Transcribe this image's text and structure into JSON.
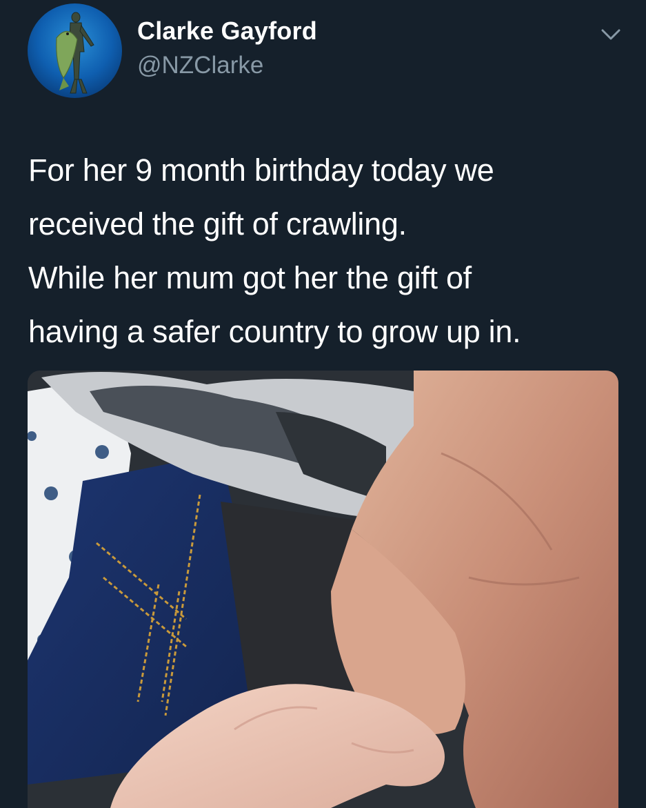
{
  "author": {
    "display_name": "Clarke Gayford",
    "handle": "@NZClarke",
    "avatar_icon": "diver-avatar-icon"
  },
  "menu": {
    "icon": "chevron-down-icon"
  },
  "tweet": {
    "lines": [
      "For her 9 month birthday today we",
      "received the gift of crawling.",
      "While her mum got her the gift of",
      "having a safer country to grow up in."
    ]
  },
  "media": {
    "description_icon": "photo-baby-hand-holding-finger"
  },
  "colors": {
    "background": "#15202b",
    "text": "#ffffff",
    "secondary_text": "#8899a6"
  }
}
